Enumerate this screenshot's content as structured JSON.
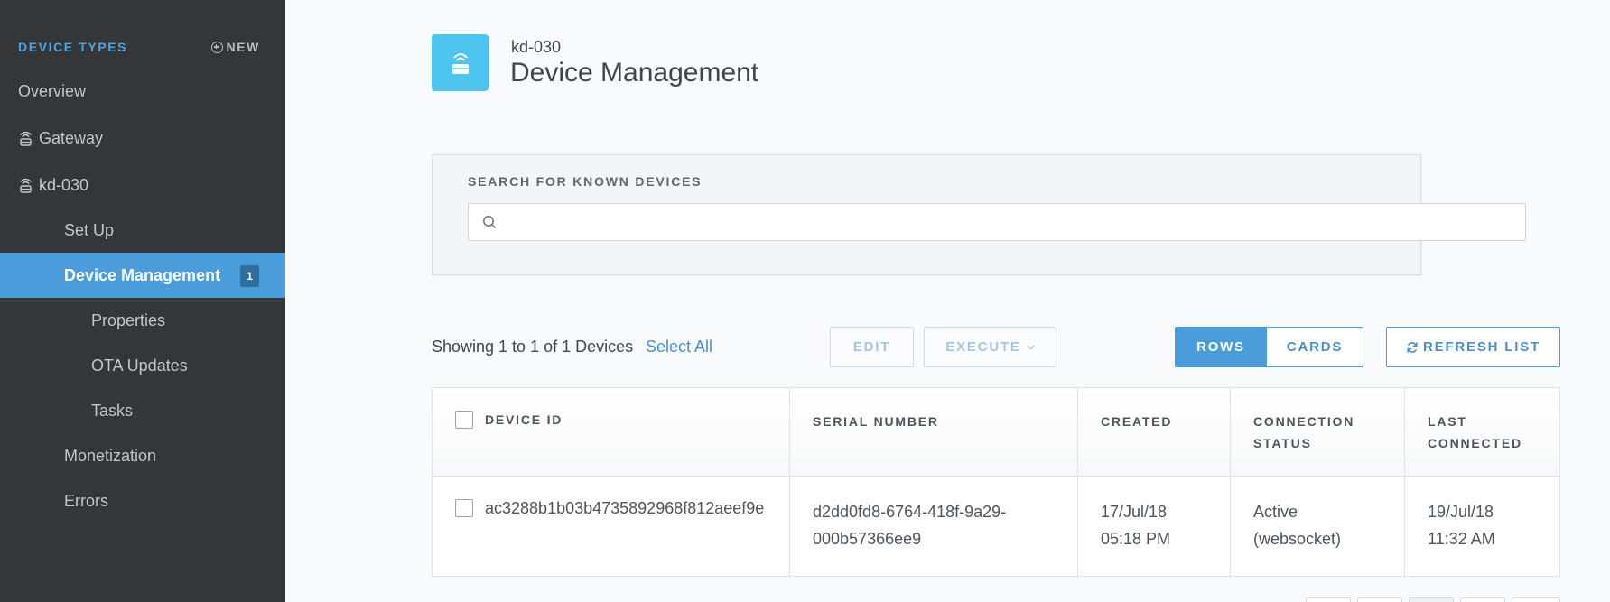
{
  "sidebar": {
    "title": "DEVICE TYPES",
    "new_label": "NEW",
    "items": [
      {
        "label": "Overview"
      },
      {
        "label": "Gateway"
      },
      {
        "label": "kd-030"
      },
      {
        "label": "Set Up"
      },
      {
        "label": "Device Management",
        "badge": "1"
      },
      {
        "label": "Properties"
      },
      {
        "label": "OTA Updates"
      },
      {
        "label": "Tasks"
      },
      {
        "label": "Monetization"
      },
      {
        "label": "Errors"
      }
    ]
  },
  "header": {
    "subtitle": "kd-030",
    "title": "Device Management",
    "icon_color": "#4ec5ee"
  },
  "search": {
    "label": "SEARCH FOR KNOWN DEVICES",
    "value": "",
    "placeholder": ""
  },
  "toolbar": {
    "showing_text": "Showing 1 to 1 of 1 Devices",
    "select_all_label": "Select All",
    "edit_label": "EDIT",
    "execute_label": "EXECUTE",
    "rows_label": "ROWS",
    "cards_label": "CARDS",
    "refresh_label": "REFRESH LIST",
    "view_mode": "ROWS"
  },
  "table": {
    "columns": [
      {
        "label": "DEVICE ID"
      },
      {
        "label": "SERIAL NUMBER"
      },
      {
        "label": "CREATED"
      },
      {
        "label": "CONNECTION",
        "label2": "STATUS"
      },
      {
        "label": "LAST",
        "label2": "CONNECTED"
      }
    ],
    "rows": [
      {
        "device_id": "ac3288b1b03b4735892968f812aeef9e",
        "serial_line1": "d2dd0fd8-6764-418f-9a29-",
        "serial_line2": "000b57366ee9",
        "created_line1": "17/Jul/18",
        "created_line2": "05:18 PM",
        "status_line1": "Active",
        "status_line2": "(websocket)",
        "last_line1": "19/Jul/18",
        "last_line2": "11:32 AM"
      }
    ]
  },
  "colors": {
    "accent": "#4a9cdb",
    "sidebar_bg": "#353638",
    "link": "#4a8fc7"
  }
}
